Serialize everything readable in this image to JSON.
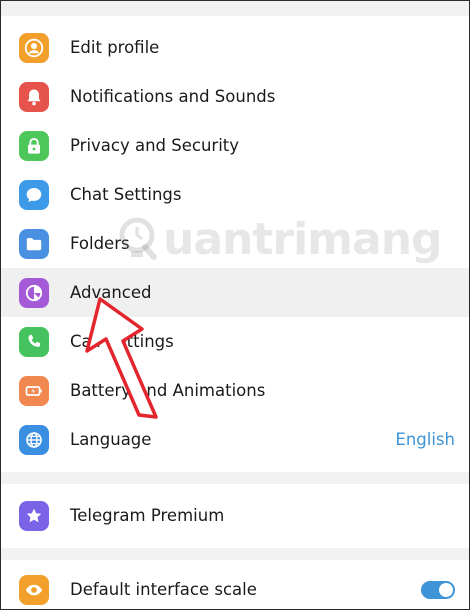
{
  "colors": {
    "accent": "#3d94d6",
    "edit_profile": "#f29f2c",
    "notifications": "#e5534b",
    "privacy": "#4ec75a",
    "chat": "#3d9ae8",
    "folders": "#4a90e2",
    "advanced": "#a45ad6",
    "calls": "#44c35e",
    "battery": "#f08850",
    "language": "#3a8fe0",
    "premium": "#7a63e6",
    "scale": "#f29f2c",
    "arrow": "#e3262e"
  },
  "settings": {
    "items": [
      {
        "label": "Edit profile",
        "icon": "person-icon"
      },
      {
        "label": "Notifications and Sounds",
        "icon": "bell-icon"
      },
      {
        "label": "Privacy and Security",
        "icon": "lock-icon"
      },
      {
        "label": "Chat Settings",
        "icon": "chat-bubble-icon"
      },
      {
        "label": "Folders",
        "icon": "folder-icon"
      },
      {
        "label": "Advanced",
        "icon": "pie-chart-icon"
      },
      {
        "label": "Call Settings",
        "icon": "phone-icon"
      },
      {
        "label": "Battery and Animations",
        "icon": "battery-icon"
      },
      {
        "label": "Language",
        "icon": "globe-icon",
        "value": "English"
      }
    ]
  },
  "premium": {
    "label": "Telegram Premium",
    "icon": "star-icon"
  },
  "scale": {
    "label": "Default interface scale",
    "icon": "eye-icon",
    "enabled": true
  },
  "watermark": {
    "text": "uantrimang"
  }
}
